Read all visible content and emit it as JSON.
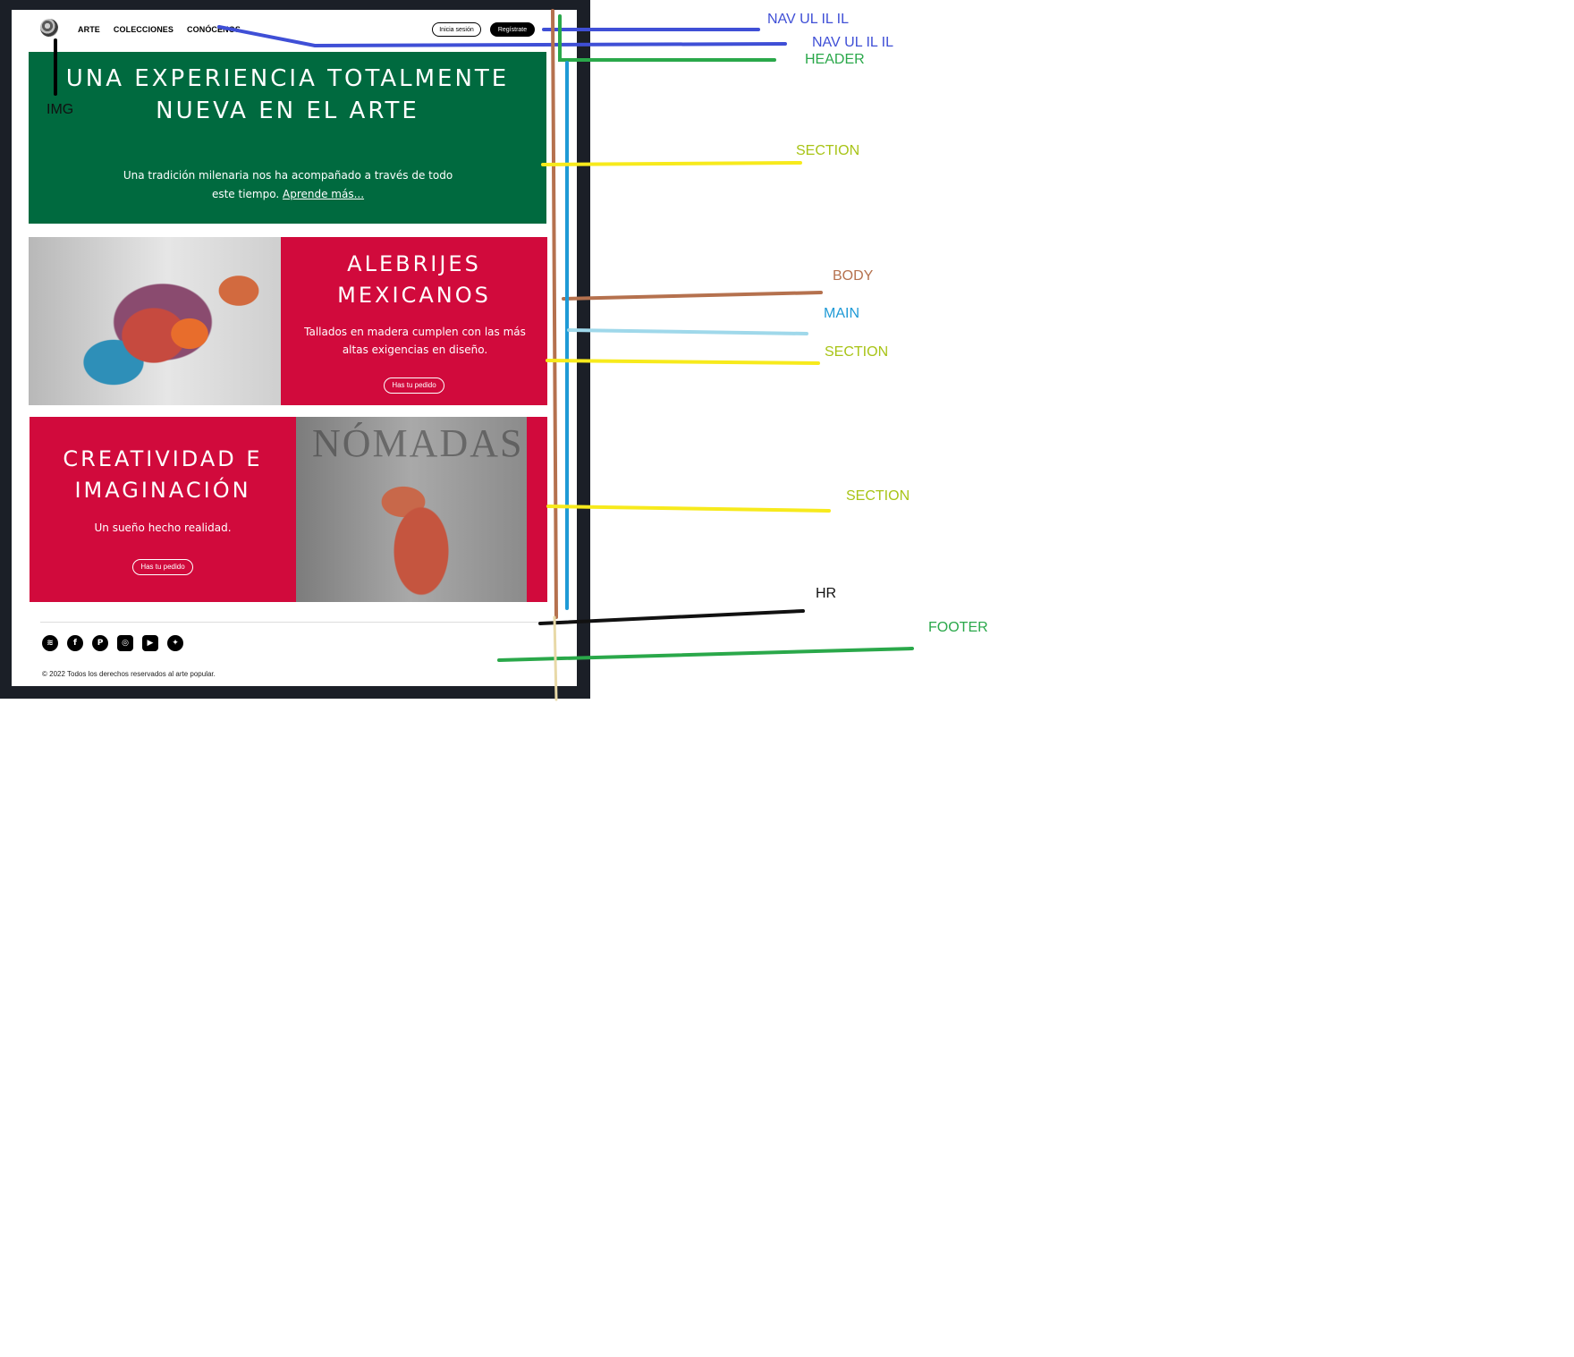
{
  "site": {
    "nav_left": [
      "ARTE",
      "COLECCIONES",
      "CONÓCENOS"
    ],
    "login_label": "Inicia sesión",
    "register_label": "Regístrate",
    "hero": {
      "title": "UNA EXPERIENCIA TOTALMENTE NUEVA EN EL ARTE",
      "text": "Una tradición milenaria nos ha acompañado a través de todo este tiempo.",
      "link": "Aprende más..."
    },
    "section2": {
      "title": "ALEBRIJES MEXICANOS",
      "text": "Tallados en madera cumplen con las más altas exigencias en diseño.",
      "button": "Has tu pedido"
    },
    "section3": {
      "title": "CREATIVIDAD E IMAGINACIÓN",
      "text": "Un sueño hecho realidad.",
      "button": "Has tu pedido",
      "image_text": "NÓMADAS"
    },
    "social": [
      "spotify-icon",
      "facebook-icon",
      "pinterest-icon",
      "instagram-icon",
      "youtube-icon",
      "twitter-icon"
    ],
    "copyright": "© 2022 Todos los derechos reservados al arte popular."
  },
  "annotations": {
    "nav1": "NAV UL IL IL",
    "nav2": "NAV UL IL IL",
    "header": "HEADER",
    "img": "IMG",
    "section1": "SECTION",
    "body": "BODY",
    "main": "MAIN",
    "section2": "SECTION",
    "section3": "SECTION",
    "hr": "HR",
    "footer": "FOOTER"
  },
  "colors": {
    "hero_bg": "#006a3f",
    "section_bg": "#d10a3c",
    "frame_bg": "#1b1f27",
    "nav_mark": "#3f4fd6",
    "header_mark": "#2aa84a",
    "body_mark": "#b5714e",
    "main_mark": "#1e9ad6",
    "section_mark": "#f7ea1c",
    "section_label": "#a8c416",
    "hr_mark": "#111111"
  }
}
